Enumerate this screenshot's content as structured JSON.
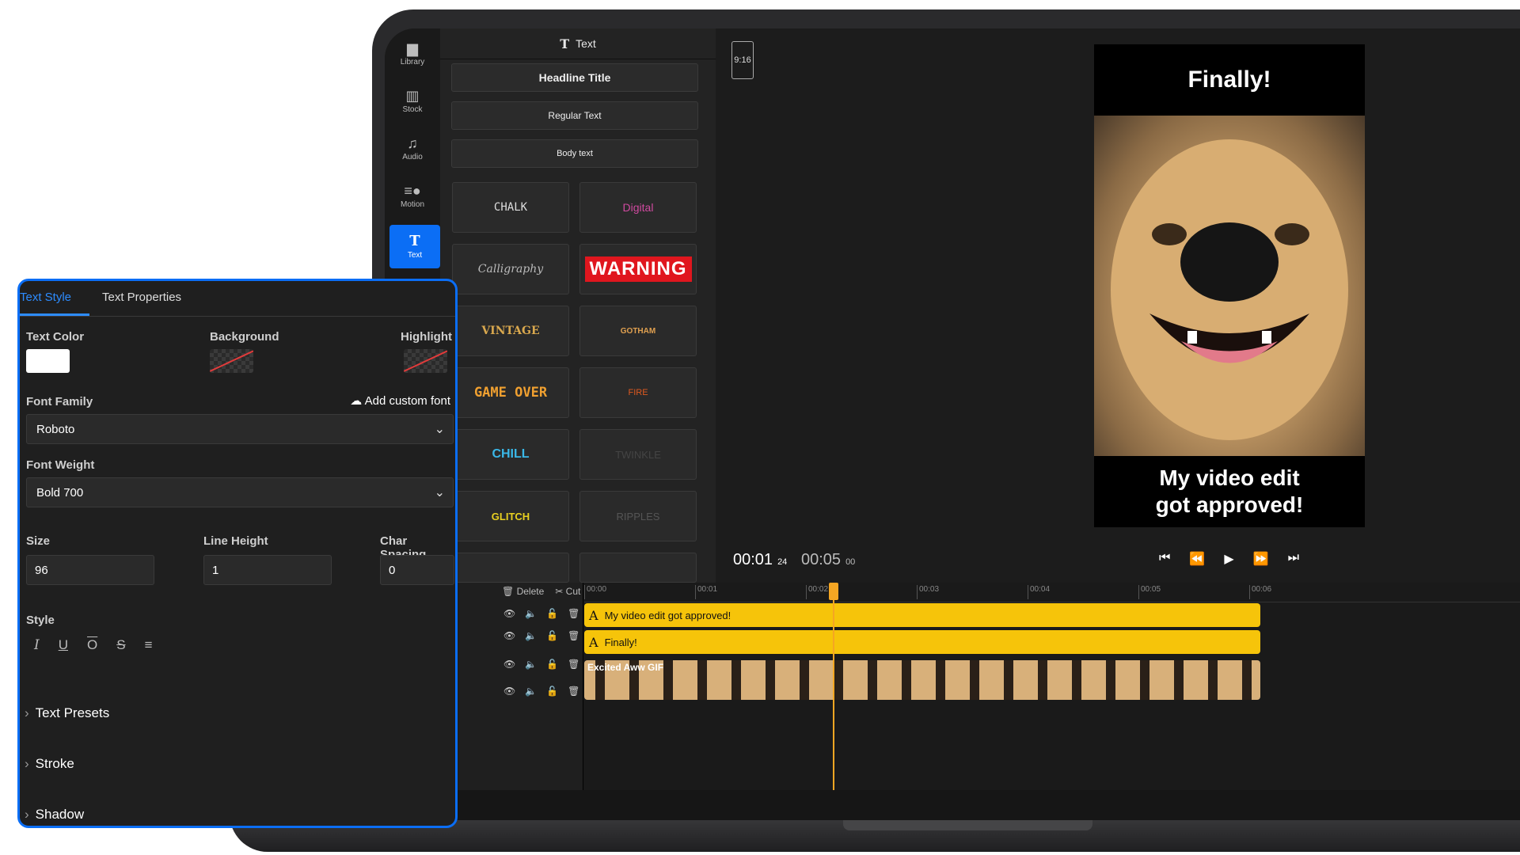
{
  "rail": {
    "items": [
      {
        "label": "Library",
        "icon": "▆"
      },
      {
        "label": "Stock",
        "icon": "▥"
      },
      {
        "label": "Audio",
        "icon": "♫"
      },
      {
        "label": "Motion",
        "icon": "≡●"
      },
      {
        "label": "Text",
        "icon": "T"
      }
    ]
  },
  "text_panel": {
    "title": "Text",
    "buttons": [
      "Headline Title",
      "Regular Text",
      "Body text"
    ],
    "presets": [
      "CHALK",
      "Digital",
      "Calligraphy",
      "WARNING",
      "VINTAGE",
      "GOTHAM",
      "GAME OVER",
      "FIRE",
      "CHILL",
      "TWINKLE",
      "GLITCH",
      "RIPPLES"
    ]
  },
  "preview": {
    "aspect": "9:16",
    "top_text": "Finally!",
    "bottom_line1": "My video edit",
    "bottom_line2": "got approved!",
    "time_current": "00:01",
    "time_current_frames": "24",
    "time_total": "00:05",
    "time_total_frames": "00"
  },
  "timeline": {
    "tools": {
      "delete": "Delete",
      "cut": "Cut"
    },
    "ticks": [
      "00:00",
      "00:01",
      "00:02",
      "00:03",
      "00:04",
      "00:05",
      "00:06"
    ],
    "tracks": [
      "ck",
      "ck",
      "ck",
      "ck"
    ],
    "clips": {
      "text1": "My video edit got approved!",
      "text2": "Finally!",
      "gif": "Excited Aww GIF"
    }
  },
  "style_panel": {
    "tabs": [
      "Text Style",
      "Text Properties"
    ],
    "text_color_label": "Text Color",
    "text_color": "#ffffff",
    "background_label": "Background",
    "highlight_label": "Highlight",
    "font_family_label": "Font Family",
    "add_font": "Add custom font",
    "font_family": "Roboto",
    "font_weight_label": "Font Weight",
    "font_weight": "Bold 700",
    "size_label": "Size",
    "size": "96",
    "line_height_label": "Line Height",
    "line_height": "1",
    "char_spacing_label": "Char Spacing",
    "char_spacing": "0",
    "style_label": "Style",
    "sections": [
      "Text Presets",
      "Stroke",
      "Shadow"
    ]
  },
  "colors": {
    "accent": "#0b6ef5",
    "clip": "#f6c40a",
    "playhead": "#f5a623"
  }
}
